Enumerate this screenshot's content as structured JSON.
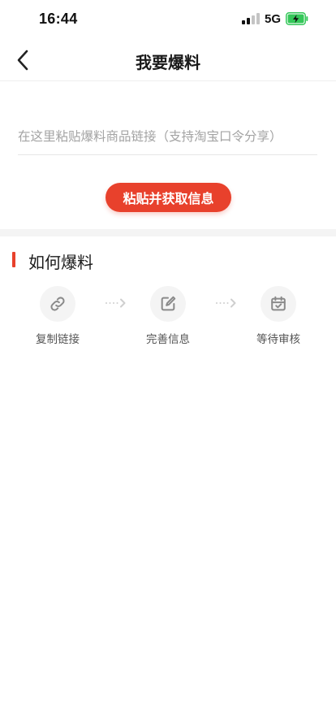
{
  "status_bar": {
    "time": "16:44",
    "network": "5G",
    "signal_icon": "cellular-signal-icon",
    "battery_icon": "battery-charging-icon",
    "battery_color": "#34c759"
  },
  "nav": {
    "back_icon": "chevron-left-icon",
    "title": "我要爆料"
  },
  "link_form": {
    "placeholder": "在这里粘贴爆料商品链接（支持淘宝口令分享）",
    "value": "",
    "paste_button_label": "粘贴并获取信息"
  },
  "how_to": {
    "title": "如何爆料",
    "steps": [
      {
        "icon": "link-icon",
        "label": "复制链接"
      },
      {
        "icon": "edit-icon",
        "label": "完善信息"
      },
      {
        "icon": "calendar-check-icon",
        "label": "等待审核"
      }
    ],
    "connector_icon": "dotted-arrow-right-icon"
  },
  "colors": {
    "accent": "#e8412c",
    "section_bg": "#f4f4f4",
    "icon_gray": "#8a8a8a"
  }
}
